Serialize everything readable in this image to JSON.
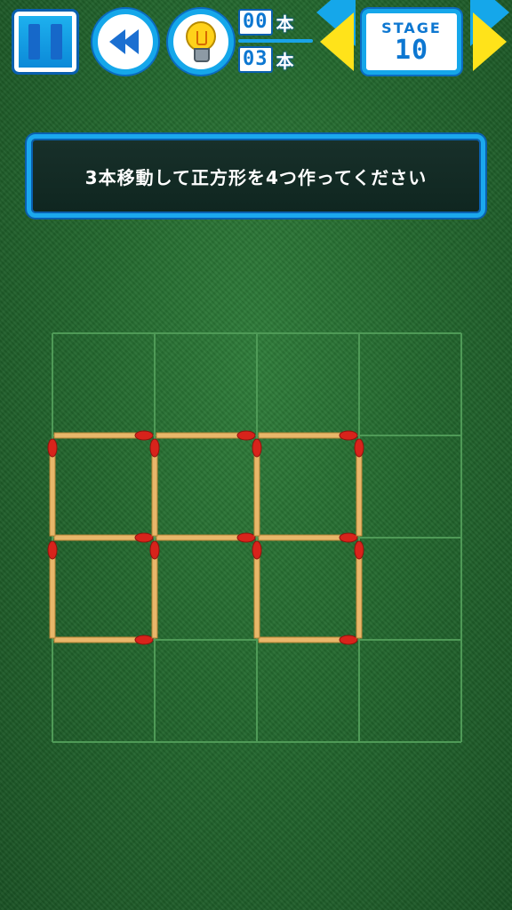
{
  "toolbar": {
    "pause_icon": "pause-icon",
    "rewind_icon": "rewind-icon",
    "hint_icon": "lightbulb-icon",
    "moved_count": "00",
    "moved_unit": "本",
    "limit_count": "03",
    "limit_unit": "本",
    "prev_icon": "triangle-left-icon",
    "next_icon": "triangle-right-icon",
    "stage_label": "STAGE",
    "stage_number": "10"
  },
  "instruction": {
    "text": "3本移動して正方形を4つ作ってください"
  },
  "board": {
    "grid_cols": 4,
    "grid_rows": 4,
    "matches": [
      {
        "orientation": "h",
        "col": 0,
        "row": 1
      },
      {
        "orientation": "h",
        "col": 1,
        "row": 1
      },
      {
        "orientation": "h",
        "col": 2,
        "row": 1
      },
      {
        "orientation": "h",
        "col": 0,
        "row": 2
      },
      {
        "orientation": "h",
        "col": 1,
        "row": 2
      },
      {
        "orientation": "h",
        "col": 2,
        "row": 2
      },
      {
        "orientation": "h",
        "col": 0,
        "row": 3
      },
      {
        "orientation": "h",
        "col": 2,
        "row": 3
      },
      {
        "orientation": "v",
        "col": 0,
        "row": 1
      },
      {
        "orientation": "v",
        "col": 1,
        "row": 1
      },
      {
        "orientation": "v",
        "col": 2,
        "row": 1
      },
      {
        "orientation": "v",
        "col": 3,
        "row": 1
      },
      {
        "orientation": "v",
        "col": 0,
        "row": 2
      },
      {
        "orientation": "v",
        "col": 1,
        "row": 2
      },
      {
        "orientation": "v",
        "col": 2,
        "row": 2
      },
      {
        "orientation": "v",
        "col": 3,
        "row": 2
      }
    ],
    "colors": {
      "stick": "#e8b76a",
      "stick_edge": "#b98437",
      "head": "#d8231b",
      "grid_line": "#4f9a57"
    }
  }
}
